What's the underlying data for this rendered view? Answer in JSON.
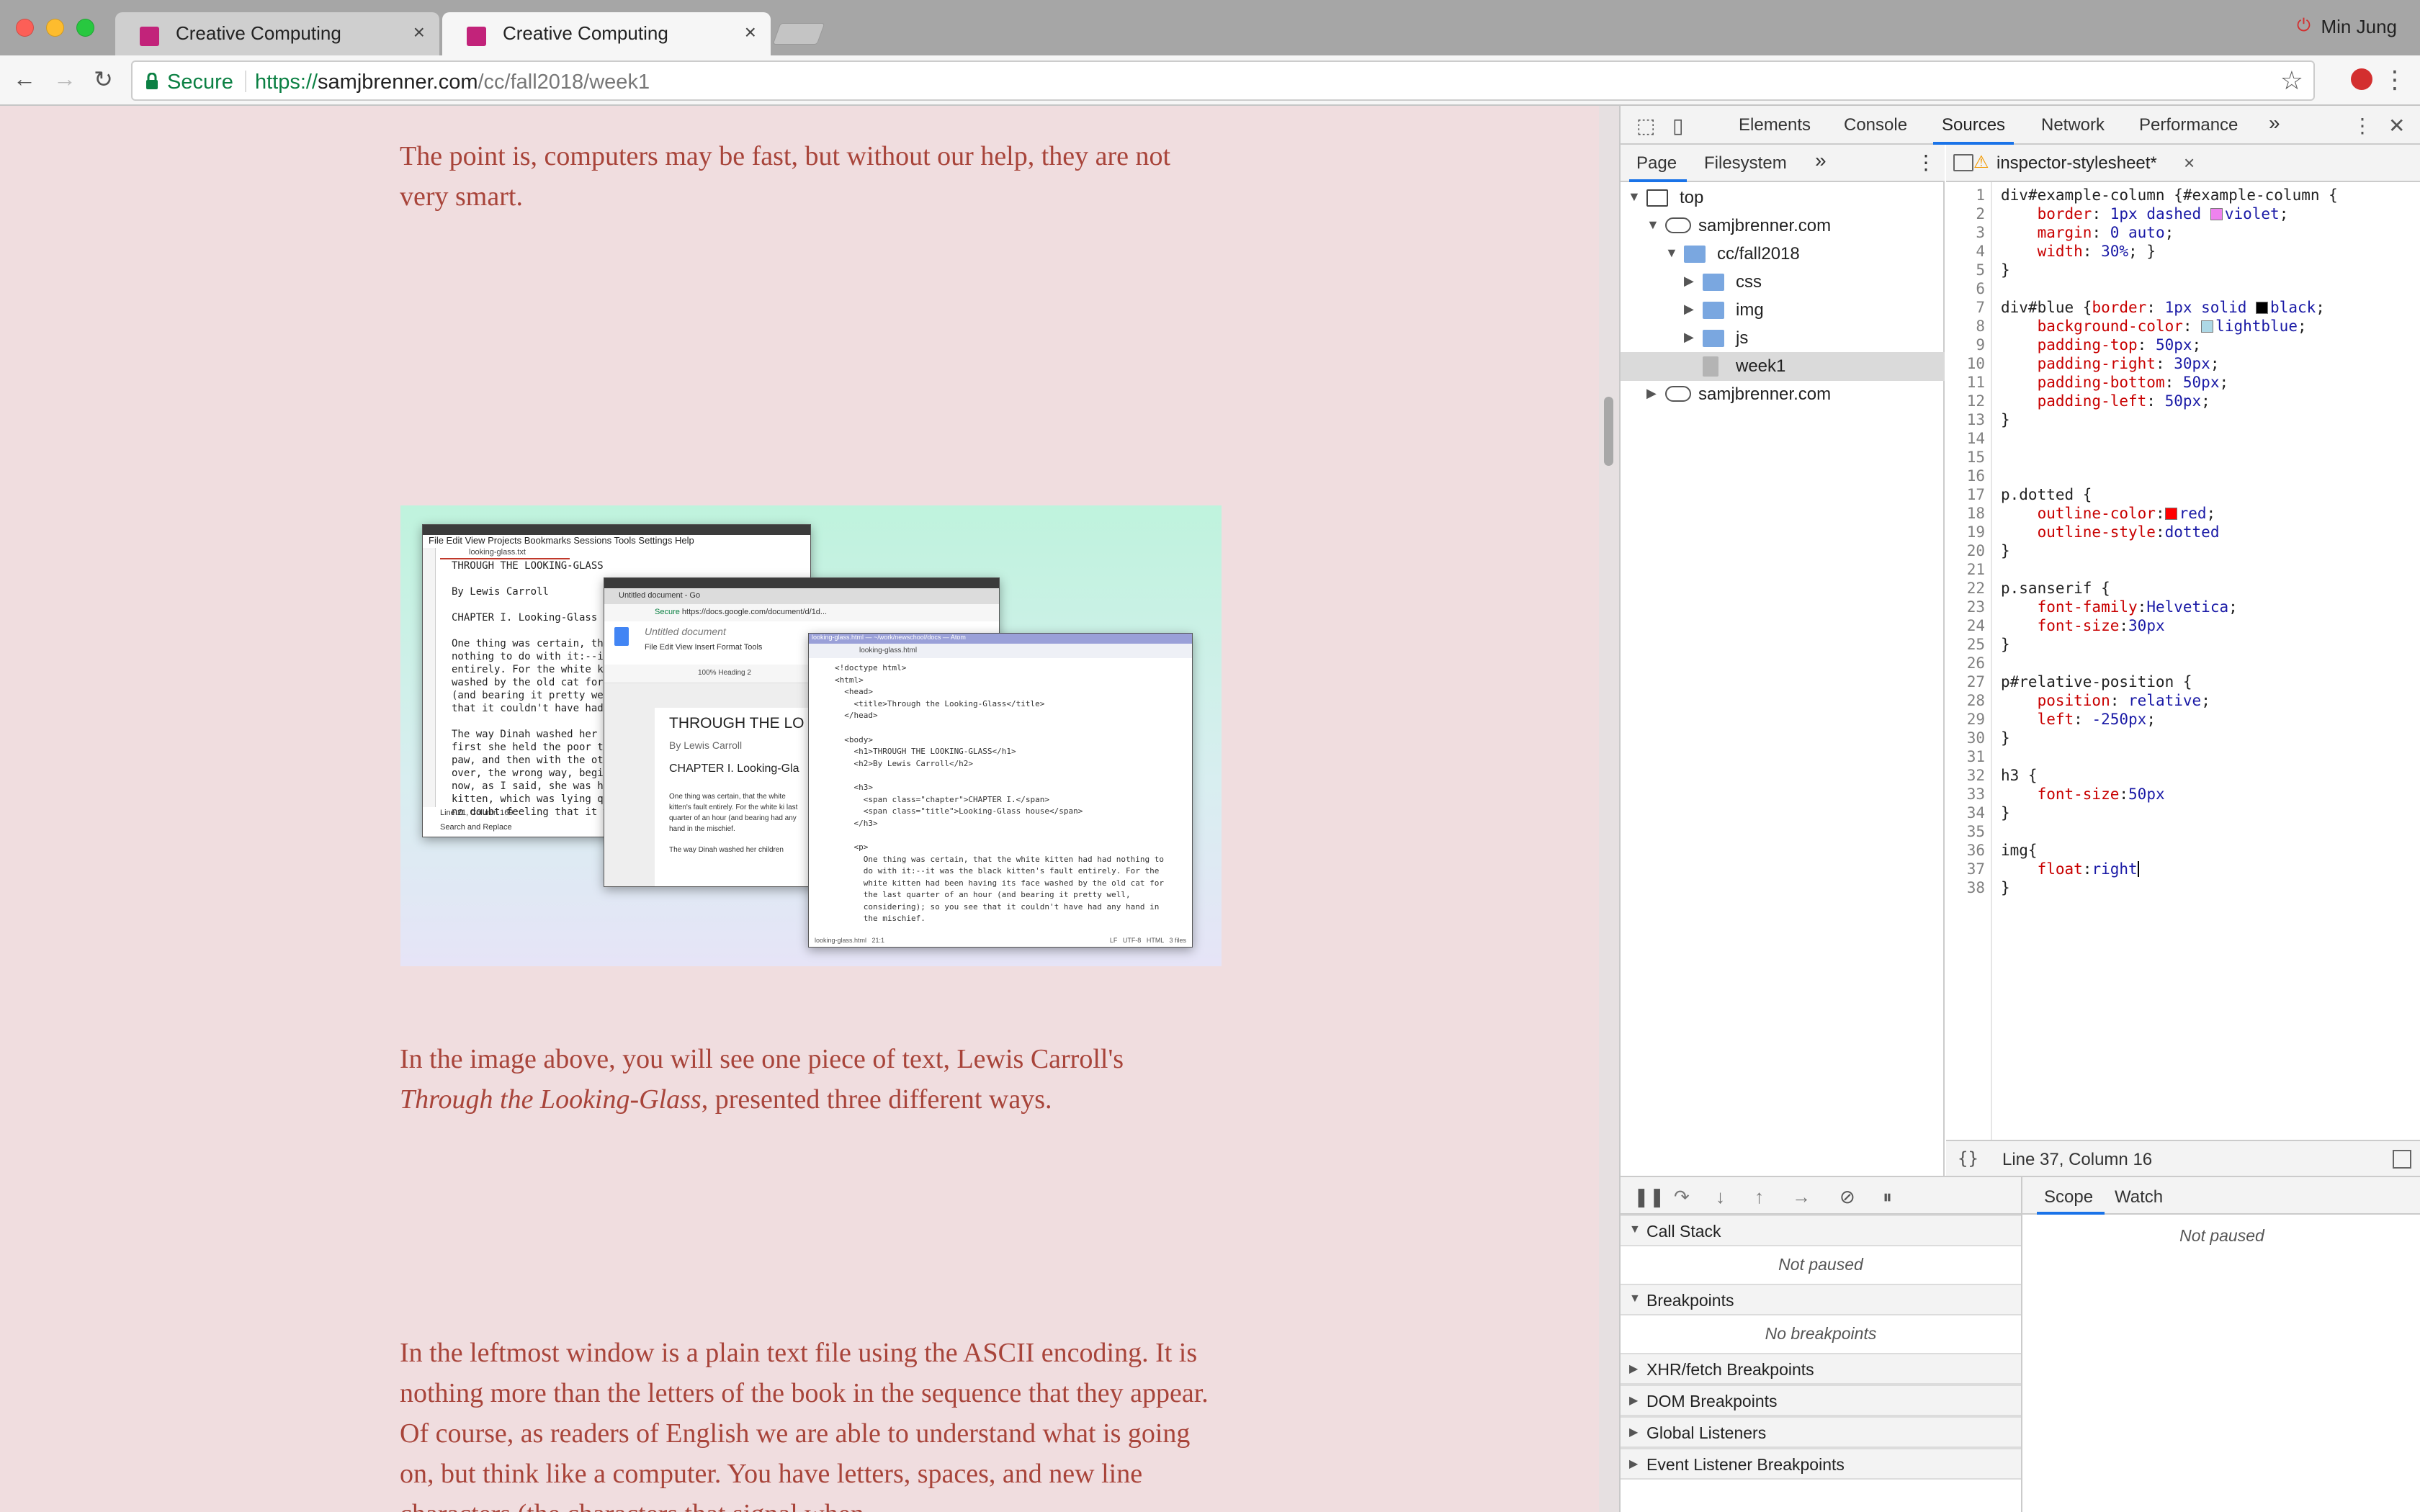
{
  "browser": {
    "tabs": [
      {
        "title": "Creative Computing"
      },
      {
        "title": "Creative Computing"
      }
    ],
    "user": "Min Jung",
    "secure_label": "Secure",
    "url": {
      "scheme": "https://",
      "host": "samjbrenner.com",
      "path": "/cc/fall2018/week1"
    }
  },
  "page": {
    "para1": "The point is, computers may be fast, but without our help, they are not very smart.",
    "para2_a": "In the image above, you will see one piece of text, Lewis Carroll's ",
    "para2_em": "Through the Looking-Glass",
    "para2_b": ", presented three different ways.",
    "para3": "In the leftmost window is a plain text file using the ASCII encoding. It is nothing more than the letters of the book in the sequence that they appear. Of course, as readers of English we are able to understand what is going on, but think like a computer. You have letters, spaces, and new line characters (the characters that signal when",
    "illustration": {
      "left_window": {
        "menu": [
          "File",
          "Edit",
          "View",
          "Projects",
          "Bookmarks",
          "Sessions",
          "Tools",
          "Settings",
          "Help"
        ],
        "tab": "looking-glass.txt",
        "lines": [
          "THROUGH THE LOOKING-GLASS",
          "",
          "By Lewis Carroll",
          "",
          "CHAPTER I. Looking-Glass h",
          "",
          "One thing was certain, th",
          "nothing to do with it:--it",
          "entirely. For the white ki",
          "washed by the old cat for",
          "(and bearing it pretty we",
          "that it couldn't have had",
          "",
          "The way Dinah washed her c",
          "first she held the poor th",
          "paw, and then with the ot",
          "over, the wrong way, begi",
          "now, as I said, she was ha",
          "kitten, which was lying qu",
          "no doubt feeling that it w"
        ],
        "status": "Line 21, Column 169",
        "footer": "Search and Replace"
      },
      "middle_window": {
        "tab": "Untitled document - Go",
        "secure": "Secure",
        "url": "https://docs.google.com/document/d/1d...",
        "doc_title": "Untitled document",
        "menu": [
          "File",
          "Edit",
          "View",
          "Insert",
          "Format",
          "Tools"
        ],
        "zoom": "100%",
        "style": "Heading 2",
        "heading": "THROUGH THE LO",
        "byline": "By Lewis Carroll",
        "chapter": "CHAPTER I. Looking-Gla",
        "body1": "One thing was certain, that the white kitten's fault entirely. For the white ki last quarter of an hour (and bearing had any hand in the mischief.",
        "body2": "The way Dinah washed her children"
      },
      "right_window": {
        "title": "looking-glass.html — ~/work/newschool/docs — Atom",
        "tab": "looking-glass.html",
        "code": [
          "<!doctype html>",
          "<html>",
          "  <head>",
          "    <title>Through the Looking-Glass</title>",
          "  </head>",
          "",
          "  <body>",
          "    <h1>THROUGH THE LOOKING-GLASS</h1>",
          "    <h2>By Lewis Carroll</h2>",
          "",
          "    <h3>",
          "      <span class=\"chapter\">CHAPTER I.</span>",
          "      <span class=\"title\">Looking-Glass house</span>",
          "    </h3>",
          "",
          "    <p>",
          "      One thing was certain, that the white kitten had had nothing to",
          "      do with it:--it was the black kitten's fault entirely. For the",
          "      white kitten had been having its face washed by the old cat for",
          "      the last quarter of an hour (and bearing it pretty well,",
          "      considering); so you see that it couldn't have had any hand in",
          "      the mischief."
        ],
        "status_left": "looking-glass.html   21:1",
        "status_right": "LF   UTF-8   HTML   3 files"
      }
    }
  },
  "devtools": {
    "tabs": [
      "Elements",
      "Console",
      "Sources",
      "Network",
      "Performance"
    ],
    "active_tab": "Sources",
    "more": "»",
    "nav_tabs": [
      "Page",
      "Filesystem"
    ],
    "tree": [
      {
        "label": "top",
        "indent": 0,
        "icon": "frame-icon",
        "arrow": "▼"
      },
      {
        "label": "samjbrenner.com",
        "indent": 1,
        "icon": "cloud-icon",
        "arrow": "▼"
      },
      {
        "label": "cc/fall2018",
        "indent": 2,
        "icon": "folder-icon",
        "arrow": "▼"
      },
      {
        "label": "css",
        "indent": 3,
        "icon": "folder-icon",
        "arrow": "▶"
      },
      {
        "label": "img",
        "indent": 3,
        "icon": "folder-icon",
        "arrow": "▶"
      },
      {
        "label": "js",
        "indent": 3,
        "icon": "folder-icon",
        "arrow": "▶"
      },
      {
        "label": "week1",
        "indent": 3,
        "icon": "file-icon",
        "arrow": "",
        "selected": true
      },
      {
        "label": "samjbrenner.com",
        "indent": 1,
        "icon": "cloud-icon",
        "arrow": "▶"
      }
    ],
    "file_tab": "inspector-stylesheet*",
    "code_lines": [
      [
        [
          "s",
          "div#example-column {#example-column {"
        ]
      ],
      [
        [
          "s",
          "    "
        ],
        [
          "p",
          "border"
        ],
        [
          "s",
          ": "
        ],
        [
          "v",
          "1px"
        ],
        [
          "s",
          " "
        ],
        [
          "v",
          "dashed"
        ],
        [
          "s",
          " "
        ],
        [
          "w",
          "#ee82ee"
        ],
        [
          "v",
          "violet"
        ],
        [
          "s",
          ";"
        ]
      ],
      [
        [
          "s",
          "    "
        ],
        [
          "p",
          "margin"
        ],
        [
          "s",
          ": "
        ],
        [
          "v",
          "0 auto"
        ],
        [
          "s",
          ";"
        ]
      ],
      [
        [
          "s",
          "    "
        ],
        [
          "p",
          "width"
        ],
        [
          "s",
          ": "
        ],
        [
          "v",
          "30%"
        ],
        [
          "s",
          "; }"
        ]
      ],
      [
        [
          "s",
          "}"
        ]
      ],
      [
        [
          "s",
          ""
        ]
      ],
      [
        [
          "s",
          "div#blue {"
        ],
        [
          "p",
          "border"
        ],
        [
          "s",
          ": "
        ],
        [
          "v",
          "1px solid"
        ],
        [
          "s",
          " "
        ],
        [
          "w",
          "#000000"
        ],
        [
          "v",
          "black"
        ],
        [
          "s",
          ";"
        ]
      ],
      [
        [
          "s",
          "    "
        ],
        [
          "p",
          "background-color"
        ],
        [
          "s",
          ": "
        ],
        [
          "w",
          "#add8e6"
        ],
        [
          "v",
          "lightblue"
        ],
        [
          "s",
          ";"
        ]
      ],
      [
        [
          "s",
          "    "
        ],
        [
          "p",
          "padding-top"
        ],
        [
          "s",
          ": "
        ],
        [
          "v",
          "50px"
        ],
        [
          "s",
          ";"
        ]
      ],
      [
        [
          "s",
          "    "
        ],
        [
          "p",
          "padding-right"
        ],
        [
          "s",
          ": "
        ],
        [
          "v",
          "30px"
        ],
        [
          "s",
          ";"
        ]
      ],
      [
        [
          "s",
          "    "
        ],
        [
          "p",
          "padding-bottom"
        ],
        [
          "s",
          ": "
        ],
        [
          "v",
          "50px"
        ],
        [
          "s",
          ";"
        ]
      ],
      [
        [
          "s",
          "    "
        ],
        [
          "p",
          "padding-left"
        ],
        [
          "s",
          ": "
        ],
        [
          "v",
          "50px"
        ],
        [
          "s",
          ";"
        ]
      ],
      [
        [
          "s",
          "}"
        ]
      ],
      [
        [
          "s",
          ""
        ]
      ],
      [
        [
          "s",
          ""
        ]
      ],
      [
        [
          "s",
          ""
        ]
      ],
      [
        [
          "s",
          "p.dotted {"
        ]
      ],
      [
        [
          "s",
          "    "
        ],
        [
          "p",
          "outline-color"
        ],
        [
          "s",
          ":"
        ],
        [
          "w",
          "#ff0000"
        ],
        [
          "v",
          "red"
        ],
        [
          "s",
          ";"
        ]
      ],
      [
        [
          "s",
          "    "
        ],
        [
          "p",
          "outline-style"
        ],
        [
          "s",
          ":"
        ],
        [
          "v",
          "dotted"
        ]
      ],
      [
        [
          "s",
          "}"
        ]
      ],
      [
        [
          "s",
          ""
        ]
      ],
      [
        [
          "s",
          "p.sanserif {"
        ]
      ],
      [
        [
          "s",
          "    "
        ],
        [
          "p",
          "font-family"
        ],
        [
          "s",
          ":"
        ],
        [
          "v",
          "Helvetica"
        ],
        [
          "s",
          ";"
        ]
      ],
      [
        [
          "s",
          "    "
        ],
        [
          "p",
          "font-size"
        ],
        [
          "s",
          ":"
        ],
        [
          "v",
          "30px"
        ]
      ],
      [
        [
          "s",
          "}"
        ]
      ],
      [
        [
          "s",
          ""
        ]
      ],
      [
        [
          "s",
          "p#relative-position {"
        ]
      ],
      [
        [
          "s",
          "    "
        ],
        [
          "p",
          "position"
        ],
        [
          "s",
          ": "
        ],
        [
          "v",
          "relative"
        ],
        [
          "s",
          ";"
        ]
      ],
      [
        [
          "s",
          "    "
        ],
        [
          "p",
          "left"
        ],
        [
          "s",
          ": "
        ],
        [
          "v",
          "-250px"
        ],
        [
          "s",
          ";"
        ]
      ],
      [
        [
          "s",
          "}"
        ]
      ],
      [
        [
          "s",
          ""
        ]
      ],
      [
        [
          "s",
          "h3 {"
        ]
      ],
      [
        [
          "s",
          "    "
        ],
        [
          "p",
          "font-size"
        ],
        [
          "s",
          ":"
        ],
        [
          "v",
          "50px"
        ]
      ],
      [
        [
          "s",
          "}"
        ]
      ],
      [
        [
          "s",
          ""
        ]
      ],
      [
        [
          "s",
          "img{"
        ]
      ],
      [
        [
          "s",
          "    "
        ],
        [
          "p",
          "float"
        ],
        [
          "s",
          ":"
        ],
        [
          "v",
          "right"
        ]
      ],
      [
        [
          "s",
          "}"
        ]
      ]
    ],
    "status": "Line 37, Column 16",
    "status_braces": "{}",
    "scope_tabs": [
      "Scope",
      "Watch"
    ],
    "scope_status": "Not paused",
    "sections": [
      {
        "label": "Call Stack",
        "open": true,
        "body": "Not paused"
      },
      {
        "label": "Breakpoints",
        "open": true,
        "body": "No breakpoints"
      },
      {
        "label": "XHR/fetch Breakpoints",
        "open": false
      },
      {
        "label": "DOM Breakpoints",
        "open": false
      },
      {
        "label": "Global Listeners",
        "open": false
      },
      {
        "label": "Event Listener Breakpoints",
        "open": false
      }
    ]
  }
}
